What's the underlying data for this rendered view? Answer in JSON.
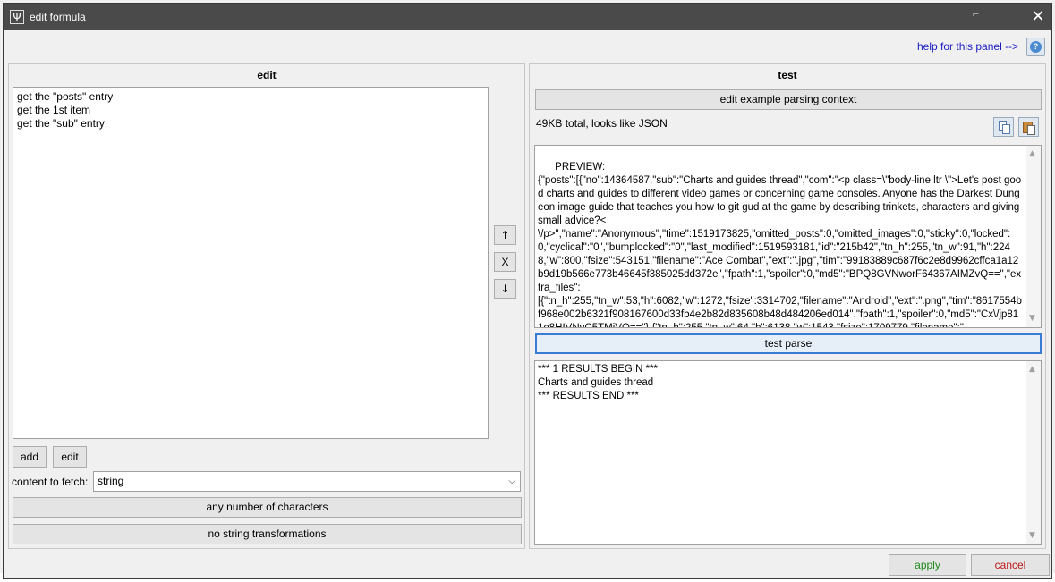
{
  "window": {
    "title": "edit formula",
    "app_icon_glyph": "Ψ",
    "close_glyph": "✕",
    "background_text": "Fad77d"
  },
  "help": {
    "link_text": "help for this panel -->",
    "icon": "help-icon"
  },
  "edit_panel": {
    "title": "edit",
    "formula_steps": [
      "get the \"posts\" entry",
      "get the 1st item",
      "get the \"sub\" entry"
    ],
    "move_up_glyph": "↑",
    "remove_glyph": "X",
    "move_down_glyph": "↓",
    "add_label": "add",
    "edit_label": "edit",
    "content_to_fetch_label": "content to fetch:",
    "content_to_fetch_value": "string",
    "chars_button_label": "any number of characters",
    "transform_button_label": "no string transformations"
  },
  "test_panel": {
    "title": "test",
    "context_button_label": "edit example parsing context",
    "size_text": "49KB total, looks like JSON",
    "preview_text": "PREVIEW:\n{\"posts\":[{\"no\":14364587,\"sub\":\"Charts and guides thread\",\"com\":\"<p class=\\\"body-line ltr \\\">Let's post good charts and guides to different video games or concerning game consoles. Anyone has the Darkest Dungeon image guide that teaches you how to git gud at the game by describing trinkets, characters and giving small advice?<\n\\/p>\",\"name\":\"Anonymous\",\"time\":1519173825,\"omitted_posts\":0,\"omitted_images\":0,\"sticky\":0,\"locked\":0,\"cyclical\":\"0\",\"bumplocked\":\"0\",\"last_modified\":1519593181,\"id\":\"215b42\",\"tn_h\":255,\"tn_w\":91,\"h\":2248,\"w\":800,\"fsize\":543151,\"filename\":\"Ace Combat\",\"ext\":\".jpg\",\"tim\":\"99183889c687f6c2e8d9962cffca1a12b9d19b566e773b46645f385025dd372e\",\"fpath\":1,\"spoiler\":0,\"md5\":\"BPQ8GVNworF64367AIMZvQ==\",\"extra_files\":\n[{\"tn_h\":255,\"tn_w\":53,\"h\":6082,\"w\":1272,\"fsize\":3314702,\"filename\":\"Android\",\"ext\":\".png\",\"tim\":\"8617554bf968e002b6321f908167600d33fb4e2b82d835608b48d484206ed014\",\"fpath\":1,\"spoiler\":0,\"md5\":\"Cx\\/jp811o8HIVNvC5TMiVQ==\"},{\"tn_h\":255,\"tn_w\":64,\"h\":6138,\"w\":1543,\"fsize\":1709779,\"filename\":\"",
    "test_parse_label": "test parse",
    "results": [
      "*** 1 RESULTS BEGIN ***",
      "Charts and guides thread",
      "*** RESULTS END ***"
    ]
  },
  "footer": {
    "apply_label": "apply",
    "cancel_label": "cancel"
  },
  "colors": {
    "apply": "#1f8a1f",
    "cancel": "#c01818",
    "help_link": "#1a1ac0",
    "titlebar": "#4a4a4a"
  }
}
